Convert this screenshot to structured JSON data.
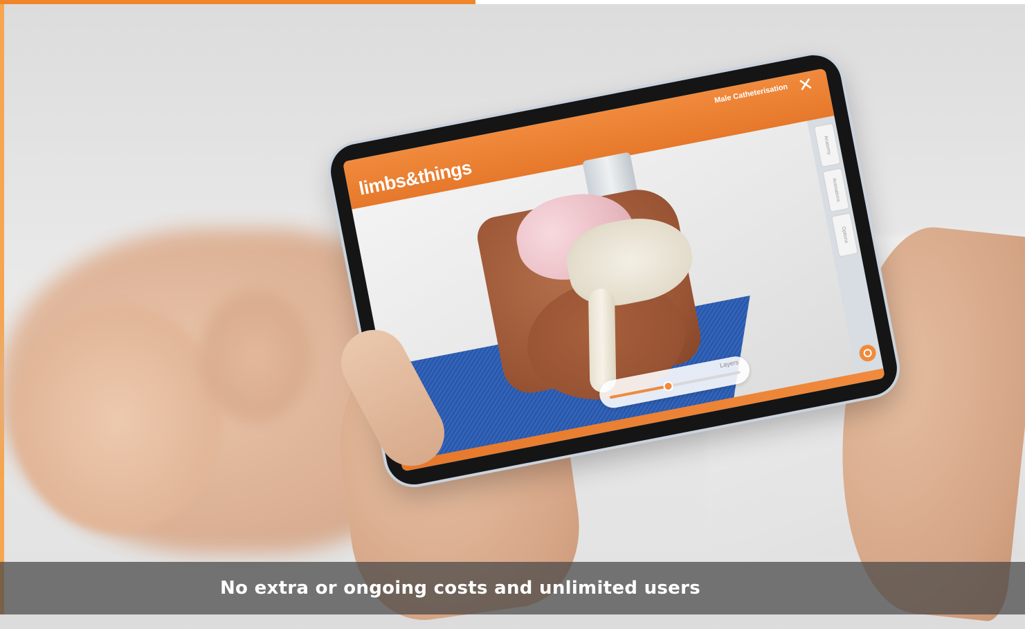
{
  "colors": {
    "accent": "#f08a3c",
    "left_border": "#f5a64f",
    "progress_fill": "#f0862a"
  },
  "video": {
    "progress_fraction": 0.464
  },
  "app": {
    "brand": "limbs&things",
    "module_title": "Male Catheterisation",
    "close_icon": "close-icon",
    "side_tabs": [
      "Anatomy",
      "Animations",
      "Options"
    ],
    "target_icon": "target-icon",
    "layers": {
      "label": "Layers",
      "value_fraction": 0.45
    }
  },
  "caption": {
    "text": "No extra or ongoing costs and unlimited users"
  }
}
